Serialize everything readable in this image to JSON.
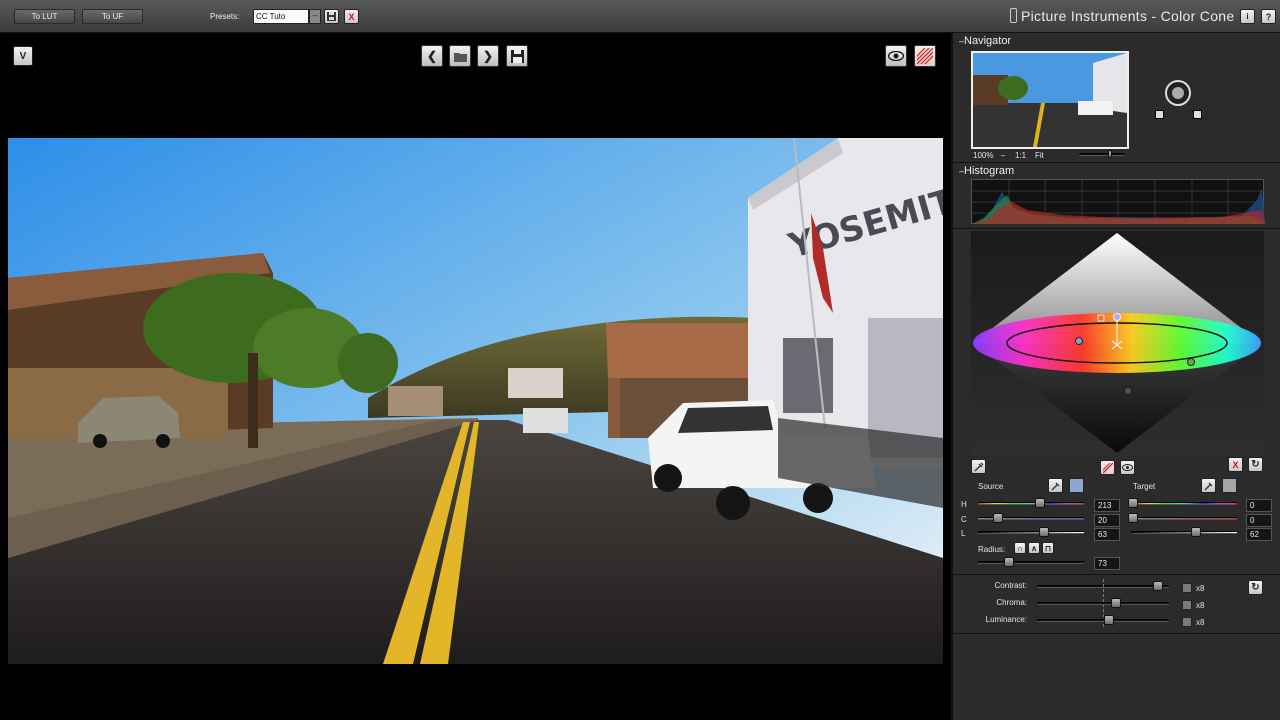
{
  "toolbar": {
    "to_lut": "To LUT",
    "to_uf": "To UF",
    "presets_label": "Presets:",
    "preset_value": "CC Tuto",
    "title": "Picture Instruments - Color Cone"
  },
  "navigator": {
    "title": "Navigator",
    "zoom_100": "100%",
    "zoom_11": "1:1",
    "zoom_fit": "Fit"
  },
  "histogram": {
    "title": "Histogram"
  },
  "source": {
    "label": "Source",
    "h_label": "H",
    "c_label": "C",
    "l_label": "L",
    "h_value": "213",
    "c_value": "20",
    "l_value": "63"
  },
  "target": {
    "label": "Target",
    "h_value": "0",
    "c_value": "0",
    "l_value": "62"
  },
  "radius": {
    "label": "Radius:",
    "value": "73"
  },
  "adjust": {
    "contrast_label": "Contrast:",
    "chroma_label": "Chroma:",
    "luminance_label": "Luminance:",
    "multiplier": "x8"
  },
  "colors": {
    "sky_top": "#2f8fe6",
    "sky_bottom": "#e6f1f7",
    "accent_red": "#d01010"
  }
}
